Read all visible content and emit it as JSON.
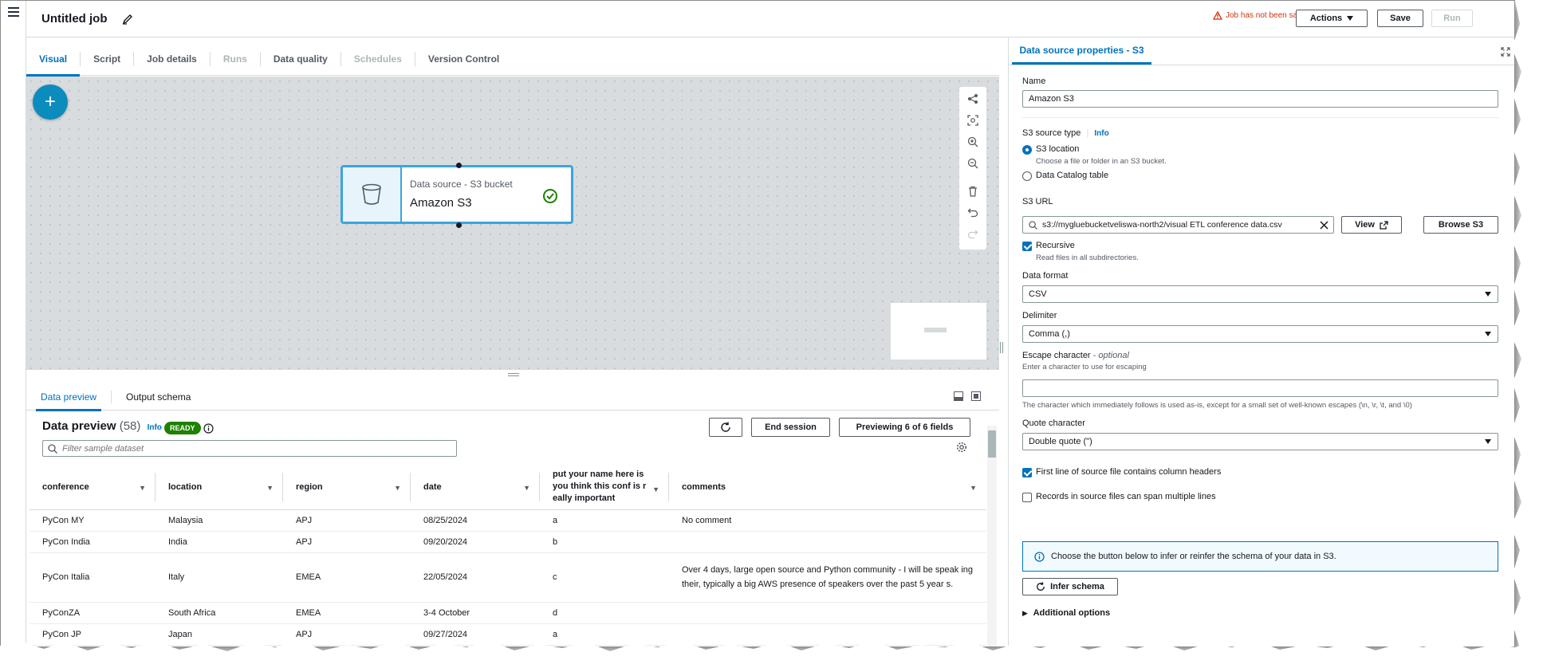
{
  "header": {
    "job_title": "Untitled job",
    "warning": "Job has not been saved",
    "actions_label": "Actions",
    "save_label": "Save",
    "run_label": "Run"
  },
  "tabs": [
    {
      "label": "Visual"
    },
    {
      "label": "Script"
    },
    {
      "label": "Job details"
    },
    {
      "label": "Runs"
    },
    {
      "label": "Data quality"
    },
    {
      "label": "Schedules"
    },
    {
      "label": "Version Control"
    }
  ],
  "canvas": {
    "add_label": "+",
    "node": {
      "subtitle": "Data source - S3 bucket",
      "title": "Amazon S3"
    }
  },
  "bottom_panel": {
    "tabs": [
      {
        "label": "Data preview"
      },
      {
        "label": "Output schema"
      }
    ],
    "title": "Data preview",
    "count": "(58)",
    "info": "Info",
    "status": "READY",
    "end_session": "End session",
    "previewing": "Previewing 6 of 6 fields",
    "filter_placeholder": "Filter sample dataset",
    "columns": [
      "conference",
      "location",
      "region",
      "date",
      "put your name here is you think this conf is r eally important",
      "comments"
    ],
    "rows": [
      [
        "PyCon MY",
        "Malaysia",
        "APJ",
        "08/25/2024",
        "a",
        "No comment"
      ],
      [
        "PyCon India",
        "India",
        "APJ",
        "09/20/2024",
        "b",
        ""
      ],
      [
        "PyCon Italia",
        "Italy",
        "EMEA",
        "22/05/2024",
        "c",
        "Over 4 days, large open source and Python community - I will be speak ing their, typically a big AWS presence of speakers over the past 5 year s."
      ],
      [
        "PyConZA",
        "South Africa",
        "EMEA",
        "3-4 October",
        "d",
        ""
      ],
      [
        "PyCon JP",
        "Japan",
        "APJ",
        "09/27/2024",
        "a",
        ""
      ]
    ]
  },
  "properties": {
    "tab": "Data source properties - S3",
    "name_label": "Name",
    "name_value": "Amazon S3",
    "source_type_label": "S3 source type",
    "info": "Info",
    "opt_s3_location": "S3 location",
    "opt_s3_location_desc": "Choose a file or folder in an S3 bucket.",
    "opt_catalog": "Data Catalog table",
    "s3_url_label": "S3 URL",
    "s3_url_value": "s3://mygluebucketveliswa-north2/visual ETL conference data.csv",
    "view_label": "View",
    "browse_label": "Browse S3",
    "recursive_label": "Recursive",
    "recursive_desc": "Read files in all subdirectories.",
    "format_label": "Data format",
    "format_value": "CSV",
    "delimiter_label": "Delimiter",
    "delimiter_value": "Comma (,)",
    "escape_label": "Escape character",
    "escape_optional": "- optional",
    "escape_desc": "Enter a character to use for escaping",
    "escape_value": "",
    "escape_note": "The character which immediately follows is used as-is, except for a small set of well-known escapes (\\n, \\r, \\t, and \\0)",
    "quote_label": "Quote character",
    "quote_value": "Double quote (\")",
    "header_label": "First line of source file contains column headers",
    "multiline_label": "Records in source files can span multiple lines",
    "infer_info": "Choose the button below to infer or reinfer the schema of your data in S3.",
    "infer_label": "Infer schema",
    "additional_label": "Additional options"
  },
  "colors": {
    "accent": "#0073bb",
    "ready": "#1d8102",
    "warning": "#d13212",
    "node_border": "#3aa5e0",
    "add_button": "#0c8cbd"
  }
}
